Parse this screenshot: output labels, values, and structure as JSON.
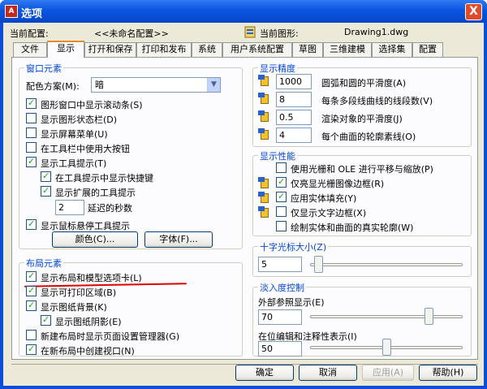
{
  "window": {
    "title": "选项",
    "close_label": "X",
    "app_icon": "A"
  },
  "header": {
    "current_profile_label": "当前配置:",
    "current_profile_value": "<<未命名配置>>",
    "current_drawing_label": "当前图形:",
    "current_drawing_value": "Drawing1.dwg",
    "drawing_icon": "drawing-icon"
  },
  "tabs": [
    "文件",
    "显示",
    "打开和保存",
    "打印和发布",
    "系统",
    "用户系统配置",
    "草图",
    "三维建模",
    "选择集",
    "配置"
  ],
  "active_tab": "显示",
  "window_elements": {
    "title": "窗口元素",
    "color_scheme_label": "配色方案(M):",
    "color_scheme_value": "暗",
    "checkboxes": [
      {
        "label": "图形窗口中显示滚动条(S)",
        "checked": true
      },
      {
        "label": "显示图形状态栏(D)",
        "checked": false
      },
      {
        "label": "显示屏幕菜单(U)",
        "checked": false
      },
      {
        "label": "在工具栏中使用大按钮",
        "checked": false
      },
      {
        "label": "显示工具提示(T)",
        "checked": true
      },
      {
        "label": "在工具提示中显示快捷键",
        "checked": true
      },
      {
        "label": "显示扩展的工具提示",
        "checked": true
      },
      {
        "label": "显示鼠标悬停工具提示",
        "checked": true
      }
    ],
    "delay_value": "2",
    "delay_label": "延迟的秒数",
    "colors_button": "颜色(C)...",
    "fonts_button": "字体(F)..."
  },
  "layout_elements": {
    "title": "布局元素",
    "checkboxes": [
      {
        "label": "显示布局和模型选项卡(L)",
        "checked": true
      },
      {
        "label": "显示可打印区域(B)",
        "checked": true
      },
      {
        "label": "显示图纸背景(K)",
        "checked": true
      },
      {
        "label": "显示图纸阴影(E)",
        "checked": true
      },
      {
        "label": "新建布局时显示页面设置管理器(G)",
        "checked": false
      },
      {
        "label": "在新布局中创建视口(N)",
        "checked": true
      }
    ]
  },
  "display_resolution": {
    "title": "显示精度",
    "rows": [
      {
        "value": "1000",
        "label": "圆弧和圆的平滑度(A)"
      },
      {
        "value": "8",
        "label": "每条多段线曲线的线段数(V)"
      },
      {
        "value": "0.5",
        "label": "渲染对象的平滑度(J)"
      },
      {
        "value": "4",
        "label": "每个曲面的轮廓素线(O)"
      }
    ]
  },
  "display_performance": {
    "title": "显示性能",
    "checkboxes": [
      {
        "label": "使用光栅和 OLE 进行平移与缩放(P)",
        "checked": false
      },
      {
        "label": "仅亮显光栅图像边框(R)",
        "checked": true
      },
      {
        "label": "应用实体填充(Y)",
        "checked": true
      },
      {
        "label": "仅显示文字边框(X)",
        "checked": false
      },
      {
        "label": "绘制实体和曲面的真实轮廓(W)",
        "checked": false
      }
    ]
  },
  "crosshair": {
    "title": "十字光标大小(Z)",
    "value": "5",
    "level_percent": 5
  },
  "fade_control": {
    "title": "淡入度控制",
    "xref_label": "外部参照显示(E)",
    "xref_value": "70",
    "xref_level_percent": 70,
    "inplace_label": "在位编辑和注释性表示(I)",
    "inplace_value": "50",
    "inplace_level_percent": 50
  },
  "buttons": {
    "ok": "确定",
    "cancel": "取消",
    "apply": "应用(A)",
    "help": "帮助(H)"
  }
}
